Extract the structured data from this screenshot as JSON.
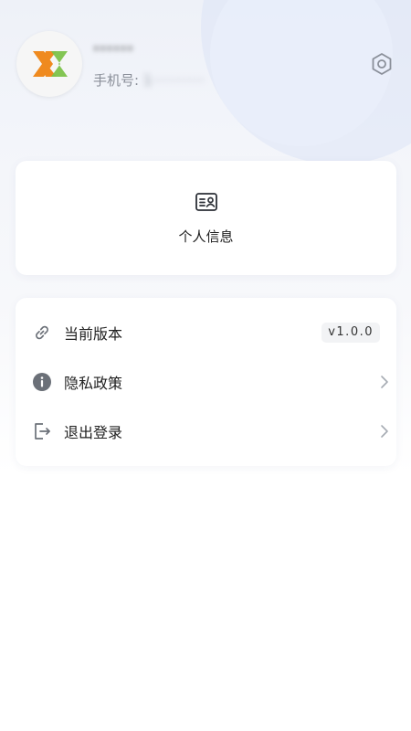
{
  "user": {
    "name": "······",
    "phone_label": "手机号:",
    "phone_value": "1··········"
  },
  "profile_card": {
    "label": "个人信息",
    "icon": "id-card-icon"
  },
  "menu": {
    "items": [
      {
        "label": "当前版本",
        "icon": "link-icon",
        "value": "v1.0.0"
      },
      {
        "label": "隐私政策",
        "icon": "info-icon"
      },
      {
        "label": "退出登录",
        "icon": "logout-icon"
      }
    ]
  },
  "colors": {
    "logo_orange": "#ef8a1f",
    "logo_green": "#7cc24a",
    "icon_gray": "#6b7078",
    "text_dark": "#1f1f1f",
    "text_muted": "#8a8f99"
  }
}
